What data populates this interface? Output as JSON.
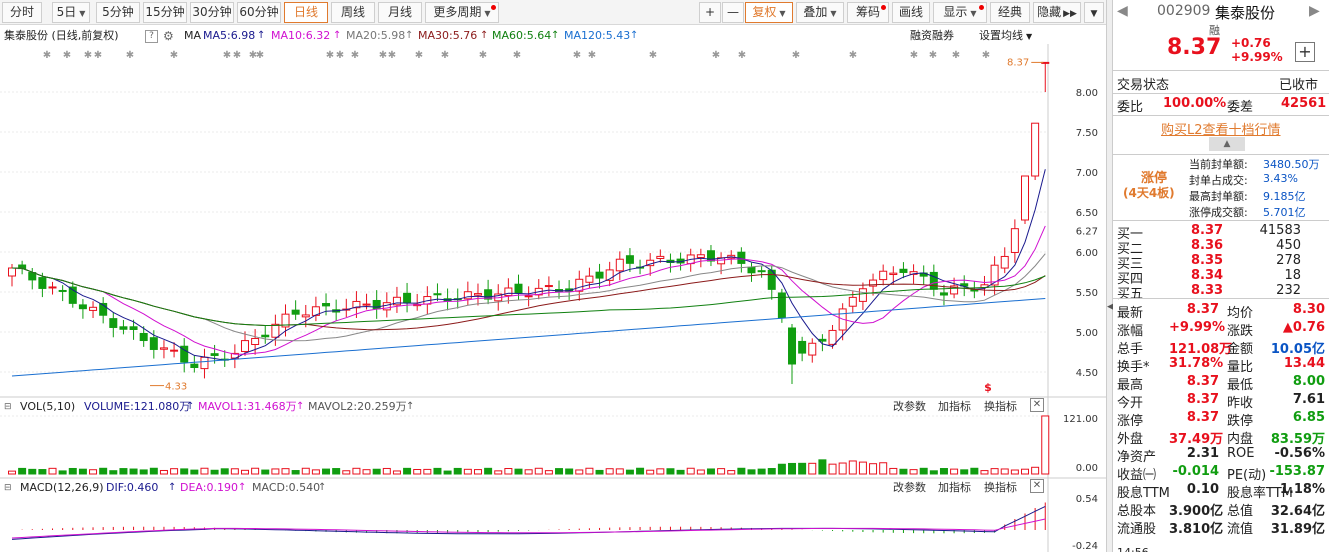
{
  "toolbar": {
    "periods": [
      "分时",
      "5日",
      "5分钟",
      "15分钟",
      "30分钟",
      "60分钟",
      "日线",
      "周线",
      "月线",
      "更多周期"
    ],
    "plus": "+",
    "minus": "—",
    "fuquan": "复权",
    "diejia": "叠加",
    "chouma": "筹码",
    "huaxian": "画线",
    "xianshi": "显示",
    "jingdian": "经典",
    "yincang": "隐藏"
  },
  "ma_line": {
    "title": "集泰股份 (日线,前复权)",
    "help": "?",
    "ma": "MA",
    "ma5": "MA5:6.98",
    "ma10": "MA10:6.32",
    "ma20": "MA20:5.98",
    "ma30": "MA30:5.76",
    "ma60": "MA60:5.64",
    "ma120": "MA120:5.43",
    "rzrq": "融资融券",
    "settings": "设置均线"
  },
  "colors": {
    "up": "#e8101d",
    "down": "#109d10",
    "ma5": "#1a1a8e",
    "ma10": "#d010d0",
    "ma20": "#888888",
    "ma30": "#8b1a1a",
    "ma60": "#108010",
    "ma120": "#1a6fd0"
  },
  "main_axis": [
    "8.00",
    "7.50",
    "7.00",
    "6.50",
    "6.27",
    "6.00",
    "5.50",
    "5.00",
    "4.50"
  ],
  "high_label": "8.37",
  "low_label": "4.33",
  "dollar": "$",
  "vol": {
    "title": "VOL(5,10)",
    "volume": "VOLUME:121.080万",
    "mavol1": "MAVOL1:31.468万",
    "mavol2": "MAVOL2:20.259万",
    "axis_top": "121.00",
    "axis_bot": "0.00",
    "params": "改参数",
    "add": "加指标",
    "switch": "换指标"
  },
  "macd": {
    "title": "MACD(12,26,9)",
    "dif": "DIF:0.460",
    "dea": "DEA:0.190",
    "macd": "MACD:0.540",
    "axis_top": "0.54",
    "axis_bot": "-0.24",
    "params": "改参数",
    "add": "加指标",
    "switch": "换指标"
  },
  "chart_data": {
    "type": "candlestick",
    "ylim": [
      4.2,
      8.6
    ],
    "last_close": 8.37,
    "high": 8.37,
    "low": 4.33,
    "ma": {
      "MA5": 6.98,
      "MA10": 6.32,
      "MA20": 5.98,
      "MA30": 5.76,
      "MA60": 5.64,
      "MA120": 5.43
    },
    "volume_last_wan": 121.08,
    "macd": {
      "DIF": 0.46,
      "DEA": 0.19,
      "MACD": 0.54
    }
  },
  "quote": {
    "code": "002909",
    "name": "集泰股份",
    "rong": "融",
    "price": "8.37",
    "chg": "+0.76",
    "pct": "+9.99%",
    "add": "+"
  },
  "status": {
    "label": "交易状态",
    "value": "已收市"
  },
  "weibi": {
    "l1": "委比",
    "v1": "100.00%",
    "l2": "委差",
    "v2": "42561"
  },
  "l2_link": "购买L2查看十档行情",
  "limit": {
    "tag1": "涨停",
    "tag2": "(4天4板)",
    "rows": [
      [
        "当前封单额:",
        "3480.50万"
      ],
      [
        "封单占成交:",
        "3.43%"
      ],
      [
        "最高封单额:",
        "9.185亿"
      ],
      [
        "涨停成交额:",
        "5.701亿"
      ]
    ]
  },
  "bids": [
    [
      "买一",
      "8.37",
      "41583"
    ],
    [
      "买二",
      "8.36",
      "450"
    ],
    [
      "买三",
      "8.35",
      "278"
    ],
    [
      "买四",
      "8.34",
      "18"
    ],
    [
      "买五",
      "8.33",
      "232"
    ]
  ],
  "stats": [
    [
      "最新",
      "8.37",
      "均价",
      "8.30"
    ],
    [
      "涨幅",
      "+9.99%",
      "涨跌",
      "▲0.76"
    ],
    [
      "总手",
      "121.08万",
      "金额",
      "10.05亿"
    ],
    [
      "换手*",
      "31.78%",
      "量比",
      "13.44"
    ],
    [
      "最高",
      "8.37",
      "最低",
      "8.00"
    ],
    [
      "今开",
      "8.37",
      "昨收",
      "7.61"
    ],
    [
      "涨停",
      "8.37",
      "跌停",
      "6.85"
    ],
    [
      "外盘",
      "37.49万",
      "内盘",
      "83.59万"
    ],
    [
      "净资产",
      "2.31",
      "ROE",
      "-0.56%"
    ],
    [
      "收益㈠",
      "-0.014",
      "PE(动)",
      "-153.87"
    ],
    [
      "股息TTM",
      "0.10",
      "股息率TTM",
      "1.18%"
    ],
    [
      "总股本",
      "3.900亿",
      "总值",
      "32.64亿"
    ],
    [
      "流通股",
      "3.810亿",
      "流值",
      "31.89亿"
    ]
  ],
  "bottom_time": "14:56"
}
